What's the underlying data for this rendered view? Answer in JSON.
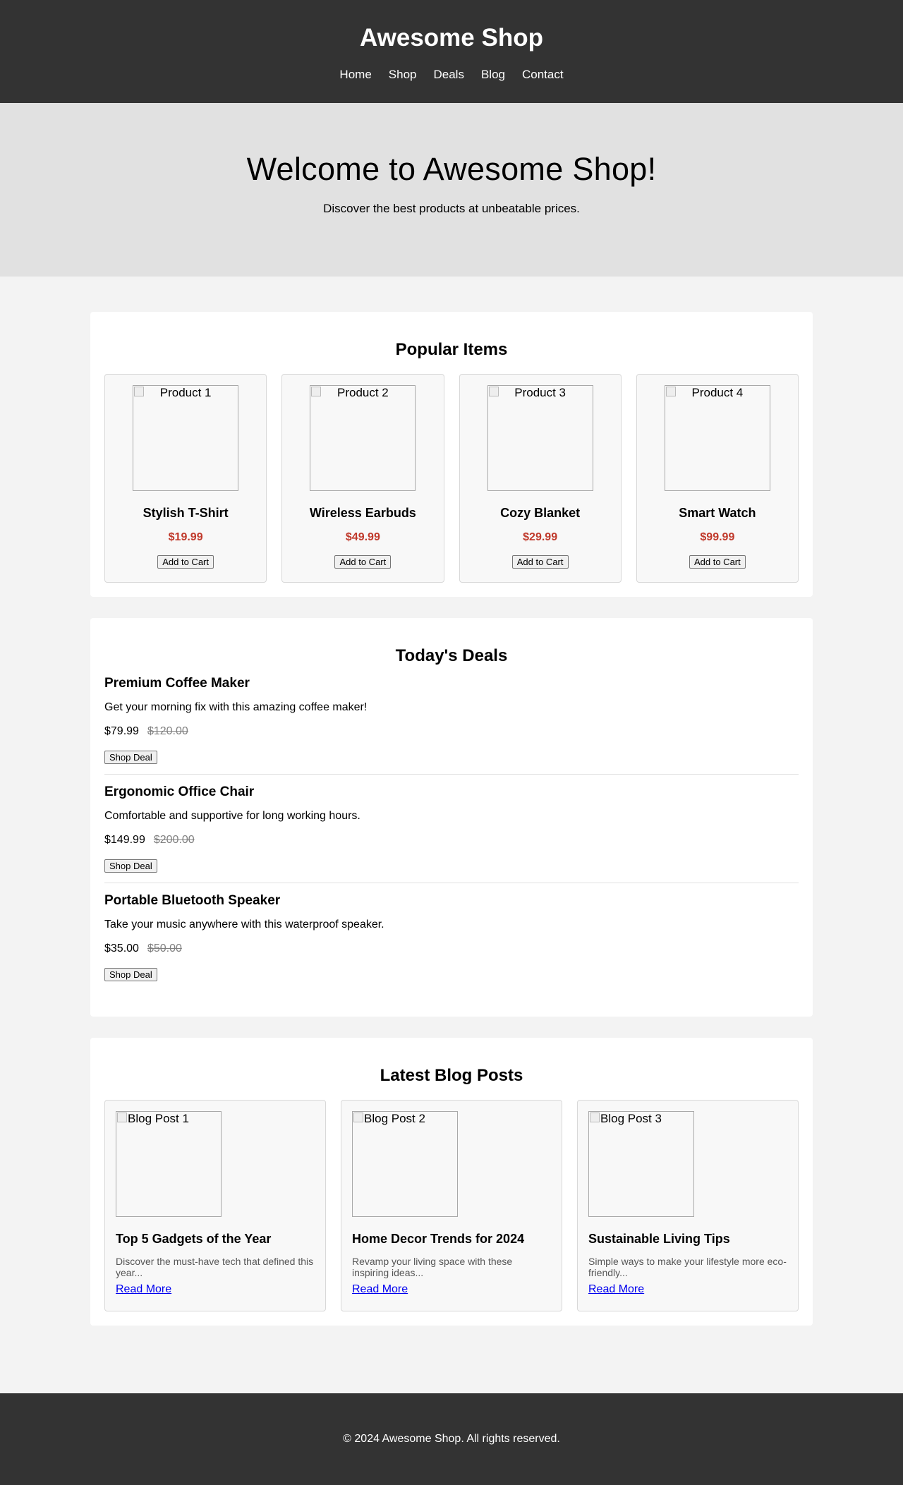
{
  "header": {
    "title": "Awesome Shop",
    "nav": [
      "Home",
      "Shop",
      "Deals",
      "Blog",
      "Contact"
    ]
  },
  "hero": {
    "title": "Welcome to Awesome Shop!",
    "subtitle": "Discover the best products at unbeatable prices."
  },
  "popular": {
    "title": "Popular Items",
    "items": [
      {
        "img_alt": "Product 1",
        "name": "Stylish T-Shirt",
        "price": "$19.99",
        "button": "Add to Cart"
      },
      {
        "img_alt": "Product 2",
        "name": "Wireless Earbuds",
        "price": "$49.99",
        "button": "Add to Cart"
      },
      {
        "img_alt": "Product 3",
        "name": "Cozy Blanket",
        "price": "$29.99",
        "button": "Add to Cart"
      },
      {
        "img_alt": "Product 4",
        "name": "Smart Watch",
        "price": "$99.99",
        "button": "Add to Cart"
      }
    ]
  },
  "deals": {
    "title": "Today's Deals",
    "items": [
      {
        "name": "Premium Coffee Maker",
        "desc": "Get your morning fix with this amazing coffee maker!",
        "price": "$79.99",
        "old_price": "$120.00",
        "button": "Shop Deal"
      },
      {
        "name": "Ergonomic Office Chair",
        "desc": "Comfortable and supportive for long working hours.",
        "price": "$149.99",
        "old_price": "$200.00",
        "button": "Shop Deal"
      },
      {
        "name": "Portable Bluetooth Speaker",
        "desc": "Take your music anywhere with this waterproof speaker.",
        "price": "$35.00",
        "old_price": "$50.00",
        "button": "Shop Deal"
      }
    ]
  },
  "blog": {
    "title": "Latest Blog Posts",
    "posts": [
      {
        "img_alt": "Blog Post 1",
        "title": "Top 5 Gadgets of the Year",
        "excerpt": "Discover the must-have tech that defined this year...",
        "link": "Read More"
      },
      {
        "img_alt": "Blog Post 2",
        "title": "Home Decor Trends for 2024",
        "excerpt": "Revamp your living space with these inspiring ideas...",
        "link": "Read More"
      },
      {
        "img_alt": "Blog Post 3",
        "title": "Sustainable Living Tips",
        "excerpt": "Simple ways to make your lifestyle more eco-friendly...",
        "link": "Read More"
      }
    ]
  },
  "footer": {
    "text": "© 2024 Awesome Shop. All rights reserved."
  },
  "colors": {
    "header_bg": "#333333",
    "hero_bg": "#e1e1e1",
    "price": "#c0392b",
    "link": "#0000ee"
  }
}
